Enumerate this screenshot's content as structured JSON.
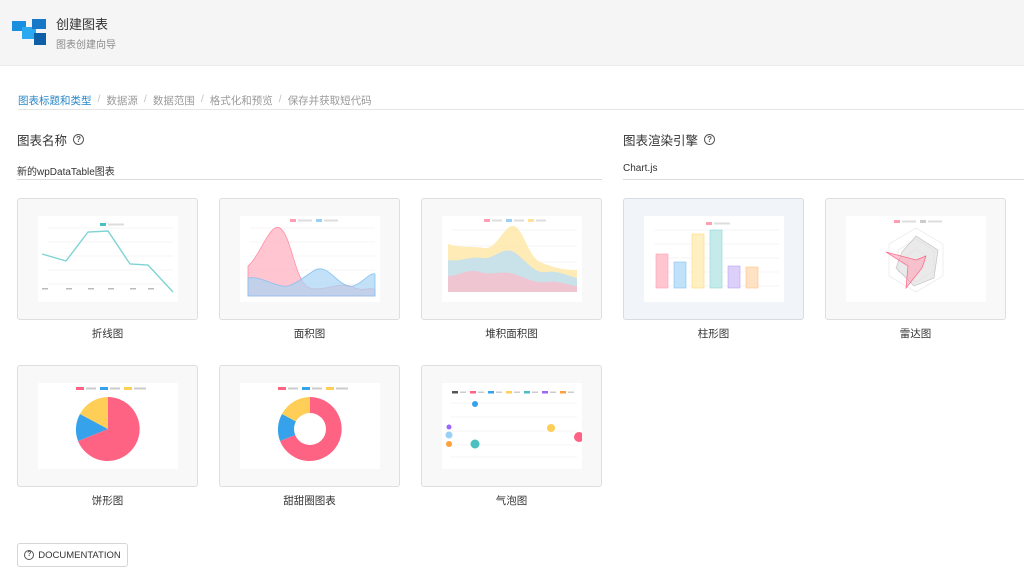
{
  "header": {
    "title": "创建图表",
    "subtitle": "图表创建向导",
    "logo_icon": "wpdatatables-logo-icon"
  },
  "breadcrumb": {
    "steps": [
      "图表标题和类型",
      "数据源",
      "数据范围",
      "格式化和预览",
      "保存并获取短代码"
    ],
    "active_index": 0,
    "active_color": "#2b87c8"
  },
  "chart_name": {
    "label": "图表名称",
    "value": "新的wpDataTable图表",
    "help_icon": "question-circle-icon"
  },
  "render_engine": {
    "label": "图表渲染引擎",
    "value": "Chart.js",
    "help_icon": "question-circle-icon"
  },
  "chart_types": [
    {
      "label": "折线图",
      "selected": false
    },
    {
      "label": "面积图",
      "selected": false
    },
    {
      "label": "堆积面积图",
      "selected": false
    },
    {
      "label": "柱形图",
      "selected": true
    },
    {
      "label": "雷达图",
      "selected": false
    },
    {
      "label": "饼形图",
      "selected": false
    },
    {
      "label": "甜甜圈图表",
      "selected": false
    },
    {
      "label": "气泡图",
      "selected": false
    }
  ],
  "documentation_button": {
    "label": "DOCUMENTATION",
    "icon": "question-circle-icon"
  },
  "colors": {
    "pink": "#ff6384",
    "blue": "#36a2eb",
    "yellow": "#ffce56",
    "teal": "#4bc0c0",
    "purple": "#9966ff",
    "orange": "#ff9f40"
  }
}
